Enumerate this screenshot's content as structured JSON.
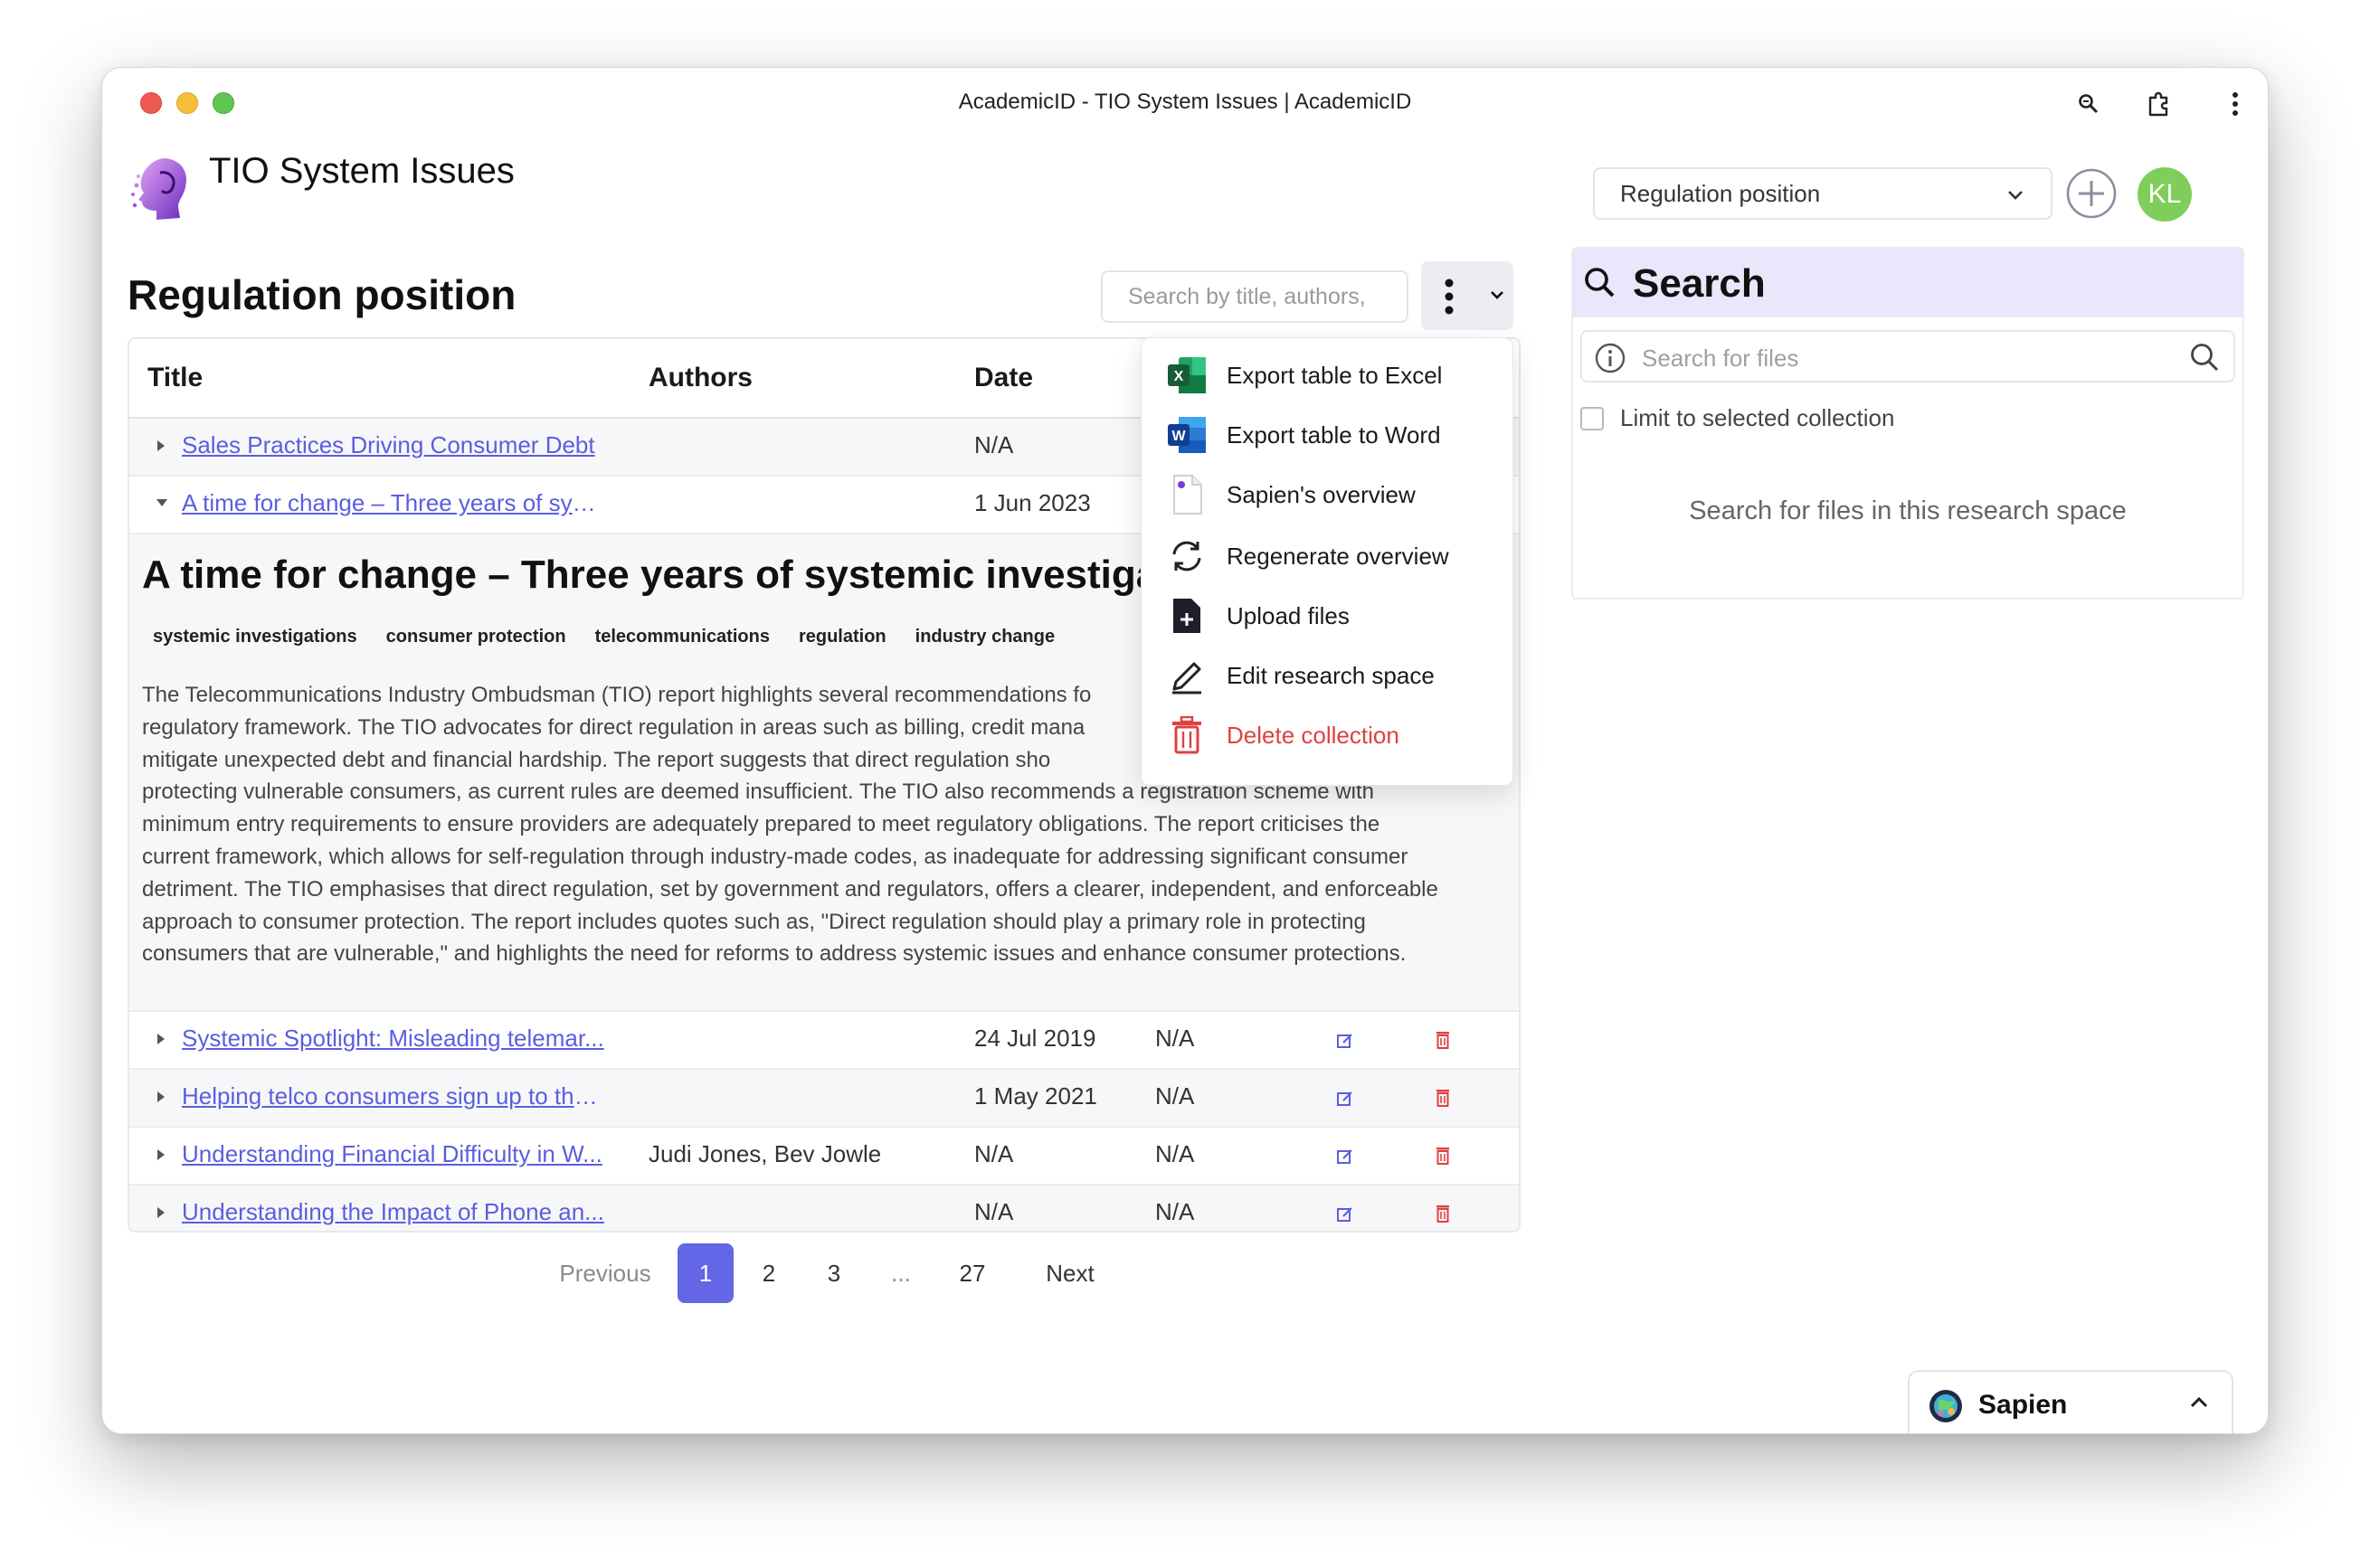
{
  "window": {
    "title": "AcademicID - TIO System Issues | AcademicID"
  },
  "header": {
    "app_title": "TIO System Issues",
    "collection_select": "Regulation position",
    "avatar_initials": "KL"
  },
  "main": {
    "page_title": "Regulation position",
    "search_placeholder": "Search by title, authors,",
    "columns": [
      "Title",
      "Authors",
      "Date"
    ],
    "rows": [
      {
        "title": "Sales Practices Driving Consumer Debt",
        "authors": "",
        "date": "N/A",
        "extra": ""
      },
      {
        "title": "A time for change – Three years of syst...",
        "authors": "",
        "date": "1 Jun 2023",
        "extra": ""
      },
      {
        "title": "Systemic Spotlight: Misleading telemar...",
        "authors": "",
        "date": "24 Jul 2019",
        "extra": "N/A"
      },
      {
        "title": "Helping telco consumers sign up to the ...",
        "authors": "",
        "date": "1 May 2021",
        "extra": "N/A"
      },
      {
        "title": "Understanding Financial Difficulty in W...",
        "authors": "Judi Jones, Bev Jowle",
        "date": "N/A",
        "extra": "N/A"
      },
      {
        "title": "Understanding the Impact of Phone an...",
        "authors": "",
        "date": "N/A",
        "extra": "N/A"
      }
    ],
    "expanded": {
      "title": "A time for change – Three years of systemic investiga",
      "tags": [
        "systemic investigations",
        "consumer protection",
        "telecommunications",
        "regulation",
        "industry change"
      ],
      "summary_lines": [
        "The Telecommunications Industry Ombudsman (TIO) report highlights several recommendations fo",
        "regulatory framework. The TIO advocates for direct regulation in areas such as billing, credit mana",
        "mitigate unexpected debt and financial hardship. The report suggests that direct regulation sho",
        "protecting vulnerable consumers, as current rules are deemed insufficient. The TIO also recommends a registration scheme with",
        "minimum entry requirements to ensure providers are adequately prepared to meet regulatory obligations. The report criticises the",
        "current framework, which allows for self-regulation through industry-made codes, as inadequate for addressing significant consumer",
        "detriment. The TIO emphasises that direct regulation, set by government and regulators, offers a clearer, independent, and enforceable",
        "approach to consumer protection. The report includes quotes such as, \"Direct regulation should play a primary role in protecting",
        "consumers that are vulnerable,\" and highlights the need for reforms to address systemic issues and enhance consumer protections."
      ]
    },
    "pagination": {
      "previous": "Previous",
      "pages": [
        "1",
        "2",
        "3",
        "...",
        "27"
      ],
      "next": "Next",
      "current": "1"
    }
  },
  "menu": {
    "items": [
      {
        "label": "Export table to Excel",
        "icon": "excel-icon"
      },
      {
        "label": "Export table to Word",
        "icon": "word-icon"
      },
      {
        "label": "Sapien's overview",
        "icon": "document-icon"
      },
      {
        "label": "Regenerate overview",
        "icon": "refresh-icon"
      },
      {
        "label": "Upload files",
        "icon": "file-plus-icon"
      },
      {
        "label": "Edit research space",
        "icon": "pencil-icon"
      },
      {
        "label": "Delete collection",
        "icon": "trash-icon"
      }
    ]
  },
  "search_panel": {
    "title": "Search",
    "placeholder": "Search for files",
    "limit_label": "Limit to selected collection",
    "empty_message": "Search for files in this research space"
  },
  "assistant": {
    "name": "Sapien"
  },
  "colors": {
    "accent": "#6366e6",
    "link": "#5a5ee0",
    "danger": "#e04040",
    "panel_head": "#ebe6fb",
    "avatar": "#7fce5c"
  }
}
